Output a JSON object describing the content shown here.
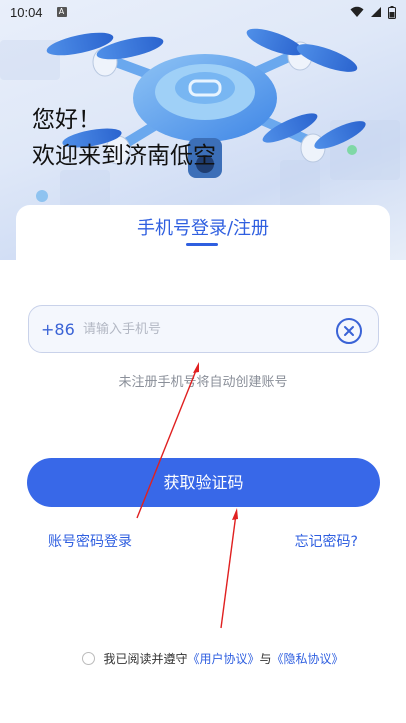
{
  "status_bar": {
    "time": "10:04",
    "notification_badge": "A",
    "icons": [
      "wifi-icon",
      "signal-icon",
      "battery-icon"
    ]
  },
  "greeting": {
    "line1": "您好！",
    "line2": "欢迎来到济南低空"
  },
  "login": {
    "tab_title": "手机号登录/注册",
    "country_code": "+86",
    "phone_placeholder": "请输入手机号",
    "phone_value": "",
    "hint": "未注册手机号将自动创建账号",
    "get_code_label": "获取验证码",
    "password_login_link": "账号密码登录",
    "forgot_password_link": "忘记密码?"
  },
  "agreement": {
    "checked": false,
    "prefix": "我已阅读并遵守",
    "user_agreement": "《用户协议》",
    "joiner": "与",
    "privacy_agreement": "《隐私协议》"
  },
  "colors": {
    "accent": "#3868e8",
    "link": "#2f5fe0",
    "annotation_arrow": "#e02020"
  }
}
